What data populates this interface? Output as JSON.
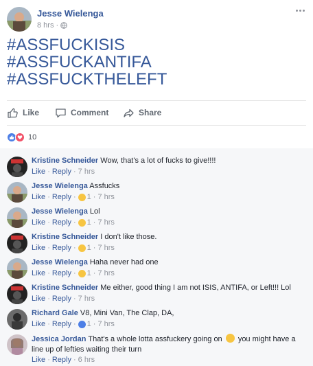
{
  "post": {
    "author": "Jesse Wielenga",
    "time": "8 hrs",
    "separator": "·",
    "lines": [
      "#ASSFUCKISIS",
      "#ASSFUCKANTIFA",
      "#ASSFUCKTHELEFT"
    ]
  },
  "actions": {
    "like": "Like",
    "comment": "Comment",
    "share": "Share"
  },
  "reactions": {
    "count": "10",
    "types": [
      "like-icon",
      "love-icon"
    ]
  },
  "comment_ui": {
    "like": "Like",
    "reply": "Reply",
    "dot": "·"
  },
  "comments": [
    {
      "author": "Kristine Schneider",
      "text": "Wow, that's a lot of fucks to give!!!!",
      "reaction_count": "",
      "reaction_icon": "",
      "time": "7 hrs",
      "avatar": "dark"
    },
    {
      "author": "Jesse Wielenga",
      "text": "Assfucks",
      "reaction_count": "1",
      "reaction_icon": "haha-icon",
      "time": "7 hrs",
      "avatar": "jesse"
    },
    {
      "author": "Jesse Wielenga",
      "text": "Lol",
      "reaction_count": "1",
      "reaction_icon": "haha-icon",
      "time": "7 hrs",
      "avatar": "jesse"
    },
    {
      "author": "Kristine Schneider",
      "text": "I don't like those.",
      "reaction_count": "1",
      "reaction_icon": "haha-icon",
      "time": "7 hrs",
      "avatar": "dark"
    },
    {
      "author": "Jesse Wielenga",
      "text": "Haha never had one",
      "reaction_count": "1",
      "reaction_icon": "haha-icon",
      "time": "7 hrs",
      "avatar": "jesse"
    },
    {
      "author": "Kristine Schneider",
      "text": "Me either, good thing I am not ISIS, ANTIFA, or Left!!! Lol",
      "reaction_count": "",
      "reaction_icon": "",
      "time": "7 hrs",
      "avatar": "dark"
    },
    {
      "author": "Richard Gale",
      "text": "V8, Mini Van, The Clap, DA,",
      "reaction_count": "1",
      "reaction_icon": "like-icon",
      "time": "7 hrs",
      "avatar": "richard"
    },
    {
      "author": "Jessica Jordan",
      "text_before": "That's a whole lotta assfuckery going on",
      "text_after": "you might have a line up of lefties waiting their turn",
      "reaction_count": "",
      "reaction_icon": "",
      "time": "6 hrs",
      "avatar": "jessica"
    }
  ],
  "colors": {
    "link": "#365899",
    "meta": "#90949c",
    "comment_bg": "#f6f7f9",
    "haha": "#f7c542",
    "like": "#4d7fe6",
    "love": "#f25268"
  }
}
